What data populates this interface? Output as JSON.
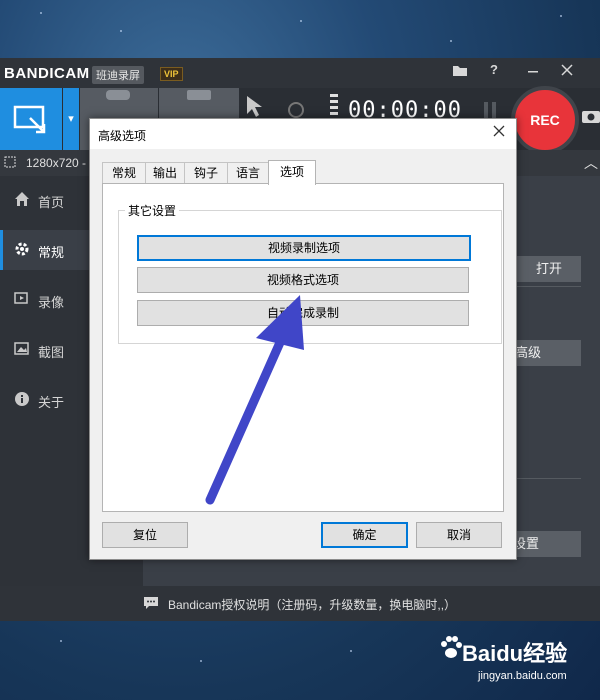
{
  "app": {
    "logo_text": "BANDICAM",
    "logo_cn": "班迪录屏",
    "vip": "VIP",
    "help_icon": "?",
    "timer": "00:00:00",
    "rec_label": "REC",
    "resolution": "1280x720 -"
  },
  "sidebar": {
    "items": [
      {
        "label": "首页",
        "icon": "home-icon"
      },
      {
        "label": "常规",
        "icon": "gear-icon"
      },
      {
        "label": "录像",
        "icon": "video-icon"
      },
      {
        "label": "截图",
        "icon": "image-icon"
      },
      {
        "label": "关于",
        "icon": "info-icon"
      }
    ]
  },
  "right_panel": {
    "open_label": "打开",
    "advanced_label": "高级",
    "settings_label": "设置"
  },
  "footer": {
    "text": "Bandicam授权说明（注册码，升级数量，换电脑时,,）"
  },
  "dialog": {
    "title": "高级选项",
    "tabs": [
      "常规",
      "输出",
      "钩子",
      "语言",
      "选项"
    ],
    "active_tab": "选项",
    "group_label": "其它设置",
    "buttons": [
      "视频录制选项",
      "视频格式选项",
      "自动完成录制"
    ],
    "reset_label": "复位",
    "ok_label": "确定",
    "cancel_label": "取消"
  },
  "colors": {
    "accent": "#1f8ee0",
    "rec": "#e8343a",
    "arrow": "#4046c8"
  },
  "watermark": {
    "brand": "Baidu经验",
    "url": "jingyan.baidu.com"
  }
}
